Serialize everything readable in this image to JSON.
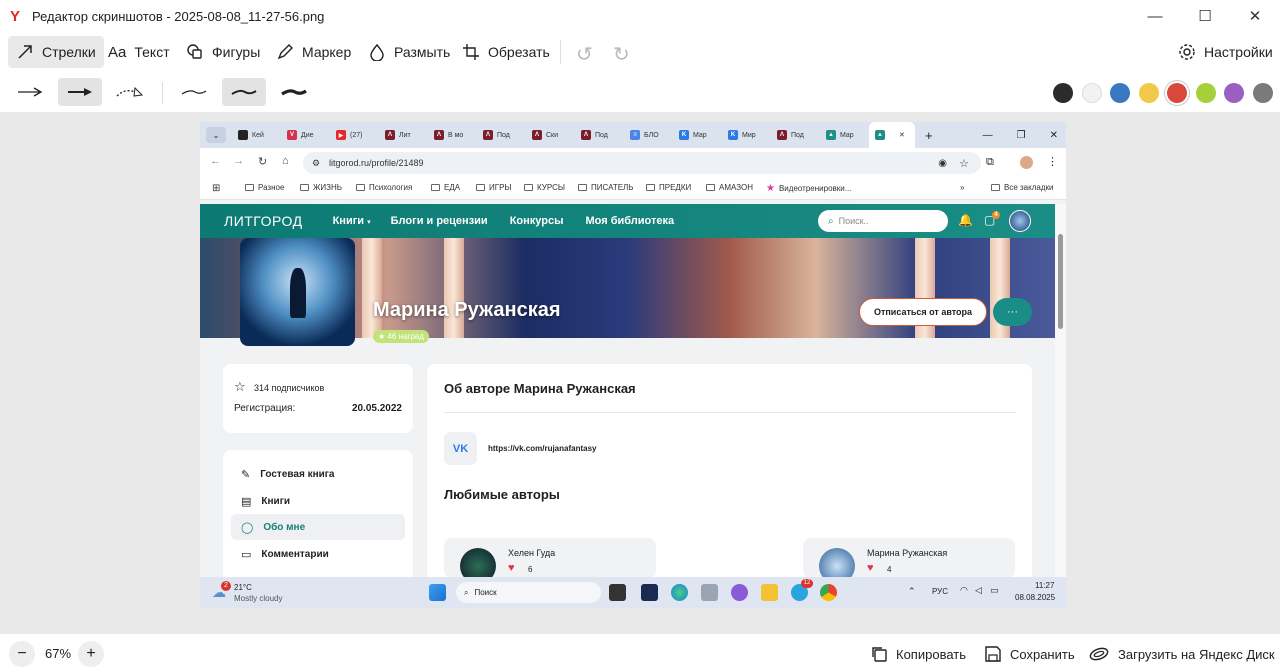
{
  "window": {
    "title": "Редактор скриншотов - 2025-08-08_11-27-56.png"
  },
  "toolbar": {
    "arrows": "Стрелки",
    "text": "Текст",
    "text_prefix": "Aa",
    "shapes": "Фигуры",
    "marker": "Маркер",
    "blur": "Размыть",
    "crop": "Обрезать",
    "settings": "Настройки"
  },
  "colors": [
    "#2b2b2b",
    "#f2f2f2",
    "#3a78c2",
    "#f2c84b",
    "#d9483b",
    "#a6cf3a",
    "#9a5fc1",
    "#7a7a7a"
  ],
  "selected_color_index": 4,
  "browser": {
    "tabs": [
      {
        "label": "Кей",
        "color": "#222"
      },
      {
        "label": "Дие",
        "color": "#d3324a",
        "glyph": "V"
      },
      {
        "label": "(27)",
        "color": "#e5282a",
        "glyph": "▶"
      },
      {
        "label": "Лит",
        "color": "#7b1d2a",
        "glyph": "Λ"
      },
      {
        "label": "В мо",
        "color": "#7b1d2a",
        "glyph": "Λ"
      },
      {
        "label": "Под",
        "color": "#7b1d2a",
        "glyph": "Λ"
      },
      {
        "label": "Ски",
        "color": "#7b1d2a",
        "glyph": "Λ"
      },
      {
        "label": "Под",
        "color": "#7b1d2a",
        "glyph": "Λ"
      },
      {
        "label": "БЛО",
        "color": "#4a86e8",
        "glyph": "≡"
      },
      {
        "label": "Мар",
        "color": "#2a7be4",
        "glyph": "K"
      },
      {
        "label": "Мир",
        "color": "#2a7be4",
        "glyph": "K"
      },
      {
        "label": "Под",
        "color": "#7b1d2a",
        "glyph": "Λ"
      },
      {
        "label": "Мар",
        "color": "#1d8f86",
        "glyph": "▲"
      },
      {
        "label": "",
        "color": "#1d8f86",
        "glyph": "▲"
      }
    ],
    "url": "litgorod.ru/profile/21489",
    "bookmarks": [
      "Разное",
      "ЖИЗНЬ",
      "Психология",
      "ЕДА",
      "ИГРЫ",
      "КУРСЫ",
      "ПИСАТЕЛЬ",
      "ПРЕДКИ",
      "АМАЗОН",
      "Видеотренировки...",
      "Все закладки"
    ]
  },
  "site": {
    "logo": "ЛИТГОРОД",
    "nav": [
      "Книги",
      "Блоги и рецензии",
      "Конкурсы",
      "Моя библиотека"
    ],
    "search_placeholder": "Поиск..",
    "notif_badge": "4",
    "author_name": "Марина Ружанская",
    "awards": "46 наград",
    "unsubscribe": "Отписаться от автора",
    "more": "···",
    "subscribers": "314 подписчиков",
    "reg_label": "Регистрация:",
    "reg_date": "20.05.2022",
    "menu": [
      "Гостевая книга",
      "Книги",
      "Обо мне",
      "Комментарии"
    ],
    "about_title": "Об авторе Марина Ружанская",
    "vk_icon": "VK",
    "vk_link": "https://vk.com/rujanafantasy",
    "fav_title": "Любимые авторы",
    "fav_authors": [
      {
        "name": "Хелен Гуда",
        "likes": "6"
      },
      {
        "name": "Марина Ружанская",
        "likes": "4"
      }
    ]
  },
  "taskbar": {
    "weather_temp": "21°C",
    "weather_desc": "Mostly cloudy",
    "weather_badge": "2",
    "search": "Поиск",
    "lang": "РУС",
    "time": "11:27",
    "date": "08.08.2025",
    "telegram_badge": "12"
  },
  "bottom": {
    "zoom": "67%",
    "copy": "Копировать",
    "save": "Сохранить",
    "upload": "Загрузить на Яндекс Диск"
  }
}
